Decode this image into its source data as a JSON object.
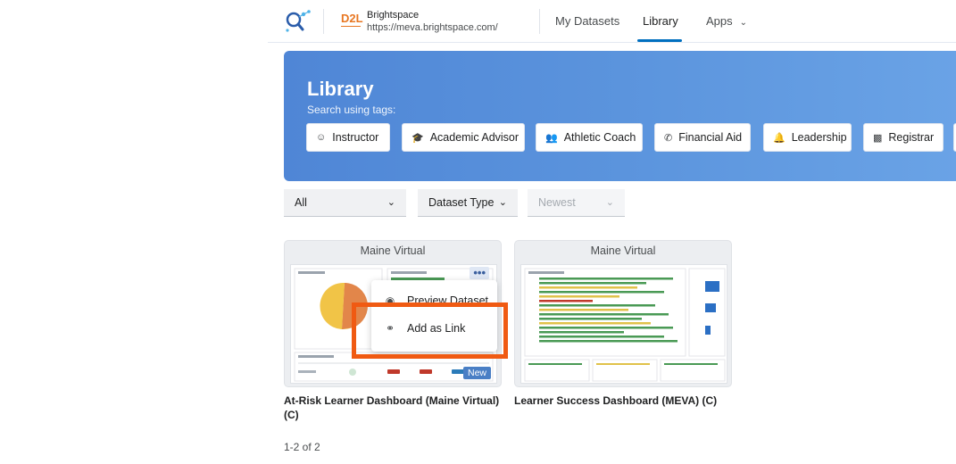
{
  "header": {
    "org_brand": "D2L",
    "org_name": "Brightspace",
    "org_url": "https://meva.brightspace.com/",
    "nav": [
      {
        "label": "My Datasets"
      },
      {
        "label": "Library",
        "active": true
      },
      {
        "label": "Apps"
      }
    ]
  },
  "banner": {
    "title": "Library",
    "subtitle": "Search using tags:",
    "tags": [
      {
        "label": "Instructor",
        "icon": "robot-icon"
      },
      {
        "label": "Academic Advisor",
        "icon": "graduation-cap-icon"
      },
      {
        "label": "Athletic Coach",
        "icon": "users-icon"
      },
      {
        "label": "Financial Aid",
        "icon": "phone-icon"
      },
      {
        "label": "Leadership",
        "icon": "bell-icon"
      },
      {
        "label": "Registrar",
        "icon": "bar-chart-icon"
      }
    ]
  },
  "filters": {
    "scope": "All",
    "dataset_type": "Dataset Type",
    "sort": "Newest"
  },
  "cards": [
    {
      "org": "Maine Virtual",
      "title_line1": "At-Risk Learner Dashboard (Maine Virtual)",
      "title_line2": "(C)",
      "badge": "New"
    },
    {
      "org": "Maine Virtual",
      "title_line1": "Learner Success Dashboard (MEVA) (C)",
      "title_line2": ""
    }
  ],
  "context_menu": {
    "items": [
      {
        "label": "Preview Dataset",
        "icon": "eye-icon"
      },
      {
        "label": "Add as Link",
        "icon": "link-icon"
      }
    ]
  },
  "pagination": {
    "summary": "1-2 of 2"
  },
  "colors": {
    "accent": "#006fbf",
    "banner": "#5b94dd",
    "highlight": "#f05a12",
    "brand": "#e87722"
  }
}
